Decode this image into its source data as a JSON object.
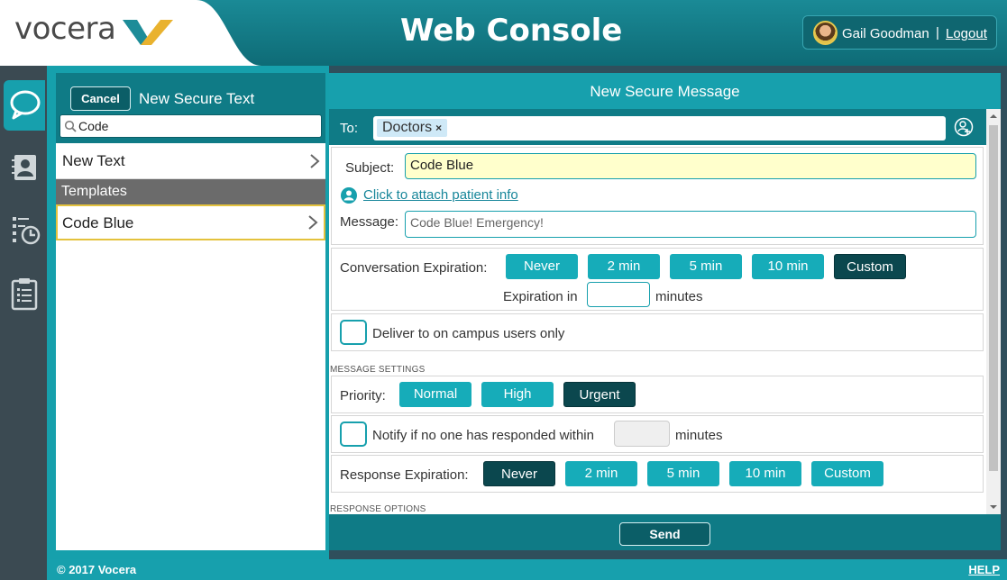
{
  "header": {
    "logo_text": "vocera",
    "title": "Web Console",
    "user_name": "Gail Goodman",
    "separator": "|",
    "logout_label": "Logout"
  },
  "rail": {
    "items": [
      {
        "icon": "chat-bubble-icon",
        "active": true
      },
      {
        "icon": "contacts-icon",
        "active": false
      },
      {
        "icon": "history-clock-icon",
        "active": false
      },
      {
        "icon": "clipboard-list-icon",
        "active": false
      }
    ]
  },
  "left_panel": {
    "cancel_label": "Cancel",
    "title": "New Secure Text",
    "search_value": "Code",
    "new_text_label": "New Text",
    "templates_header": "Templates",
    "templates": [
      "Code Blue"
    ]
  },
  "message": {
    "header": "New Secure Message",
    "to_label": "To:",
    "recipients": [
      "Doctors"
    ],
    "chip_remove": "×",
    "subject_label": "Subject:",
    "subject_value": "Code Blue",
    "attach_link": "Click to attach patient info",
    "message_label": "Message:",
    "message_value": "Code Blue! Emergency!",
    "conversation_expiration": {
      "label": "Conversation Expiration:",
      "options": [
        "Never",
        "2 min",
        "5 min",
        "10 min",
        "Custom"
      ],
      "selected": "Custom",
      "expiration_in_label": "Expiration in",
      "minutes_label": "minutes"
    },
    "campus_only_label": "Deliver to on campus users only",
    "message_settings_caption": "MESSAGE SETTINGS",
    "priority": {
      "label": "Priority:",
      "options": [
        "Normal",
        "High",
        "Urgent"
      ],
      "selected": "Urgent"
    },
    "notify": {
      "label": "Notify if no one has responded within",
      "minutes_label": "minutes"
    },
    "response_expiration": {
      "label": "Response Expiration:",
      "options": [
        "Never",
        "2 min",
        "5 min",
        "10 min",
        "Custom"
      ],
      "selected": "Never"
    },
    "response_options_caption": "RESPONSE OPTIONS",
    "send_label": "Send"
  },
  "footer": {
    "copyright": "© 2017 Vocera",
    "help_label": "HELP"
  },
  "colors": {
    "teal": "#17a0ad",
    "dark_teal": "#0f7b86",
    "selected_button": "#0b474e",
    "subject_highlight": "#ffffcc",
    "rail": "#3b4a52",
    "template_highlight": "#e4c23d"
  }
}
